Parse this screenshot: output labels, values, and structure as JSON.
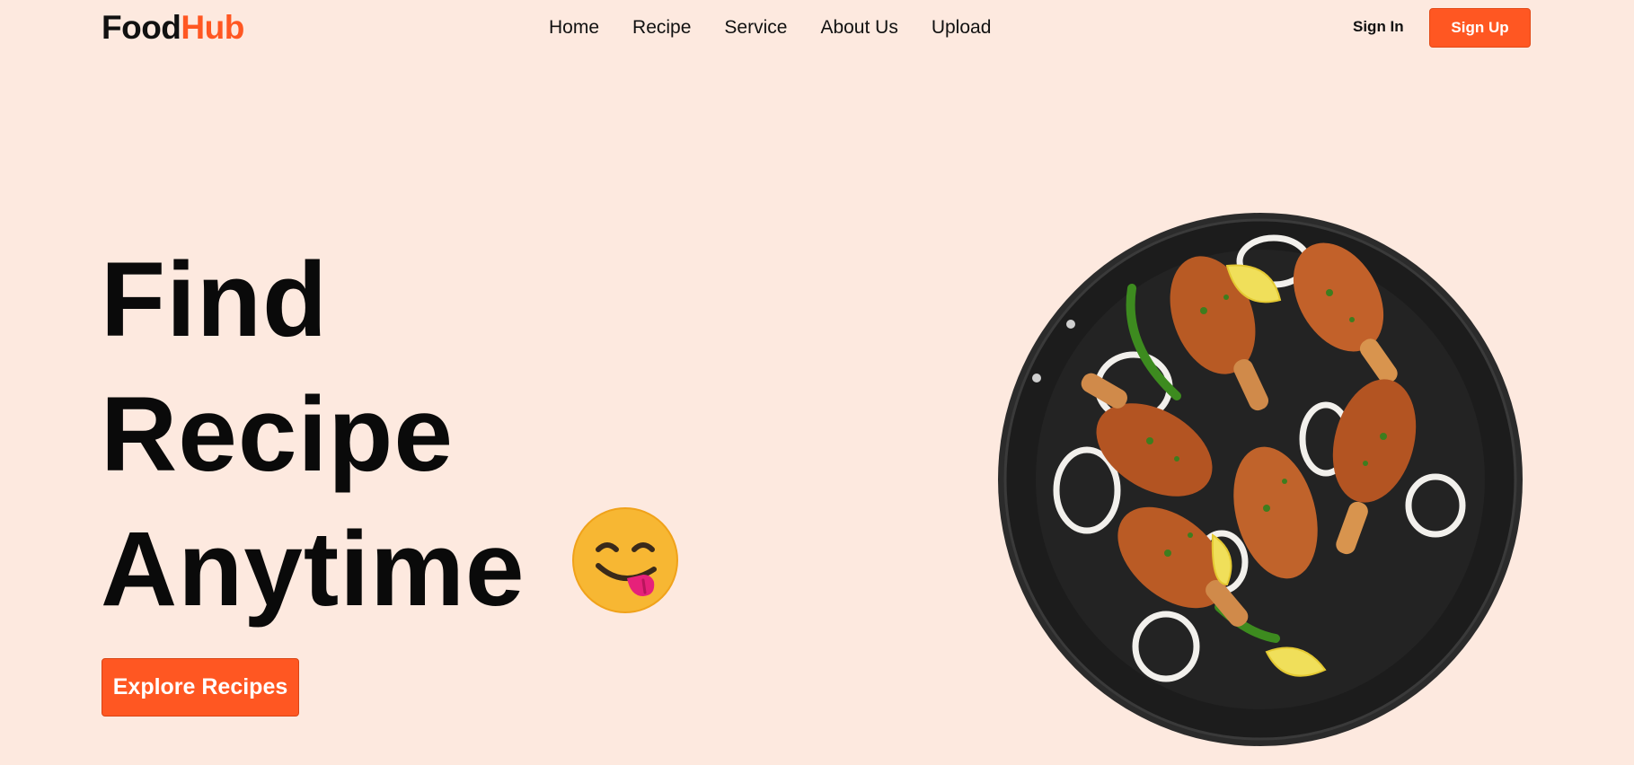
{
  "brand": {
    "part1": "Food",
    "part2": "Hub",
    "accent_color": "#ff5722"
  },
  "nav": {
    "items": [
      {
        "label": "Home"
      },
      {
        "label": "Recipe"
      },
      {
        "label": "Service"
      },
      {
        "label": "About Us"
      },
      {
        "label": "Upload"
      }
    ]
  },
  "auth": {
    "sign_in": "Sign In",
    "sign_up": "Sign Up"
  },
  "hero": {
    "lines": [
      "Find",
      "Recipe",
      "Anytime"
    ],
    "emoji": "face-savoring-food-icon",
    "cta": "Explore Recipes",
    "image": "chicken-drumsticks-pan"
  },
  "colors": {
    "background": "#fde9df",
    "accent": "#ff5722",
    "text": "#111111"
  }
}
